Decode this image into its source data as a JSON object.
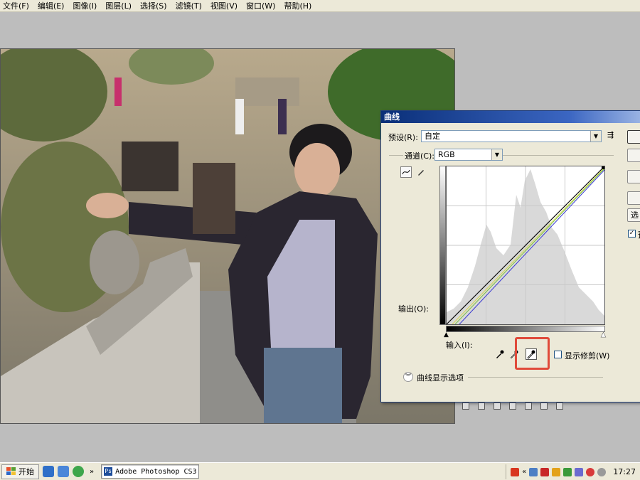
{
  "menu": [
    "文件(F)",
    "编辑(E)",
    "图像(I)",
    "图层(L)",
    "选择(S)",
    "滤镜(T)",
    "视图(V)",
    "窗口(W)",
    "帮助(H)"
  ],
  "dialog": {
    "title": "曲线",
    "preset_label": "预设(R):",
    "preset_value": "自定",
    "channel_label": "通道(C):",
    "channel_value": "RGB",
    "output_label": "输出(O):",
    "input_label": "输入(I):",
    "show_clipping_label": "显示修剪(W)",
    "show_clipping_checked": false,
    "options_label": "曲线显示选项",
    "side_buttons": [
      "",
      "",
      "",
      "",
      "选"
    ],
    "side_checkbox_label": "预",
    "side_checkbox_checked": true
  },
  "taskbar": {
    "start_label": "开始",
    "window_label": "Adobe Photoshop CS3",
    "overflow": "»",
    "tray_chevron": "«",
    "clock": "17:27"
  },
  "colors": {
    "highlight_box": "#e04a3a",
    "title_bar": "#0a2f78",
    "curve_rgb": "#000000",
    "curve_green": "#7dc241",
    "curve_blue": "#3a3ad0",
    "curve_yellow": "#d8d850"
  },
  "icons": [
    "curve-tool-icon",
    "pencil-tool-icon",
    "black-eyedropper-icon",
    "gray-eyedropper-icon",
    "white-eyedropper-icon",
    "preset-options-icon",
    "expand-icon"
  ]
}
